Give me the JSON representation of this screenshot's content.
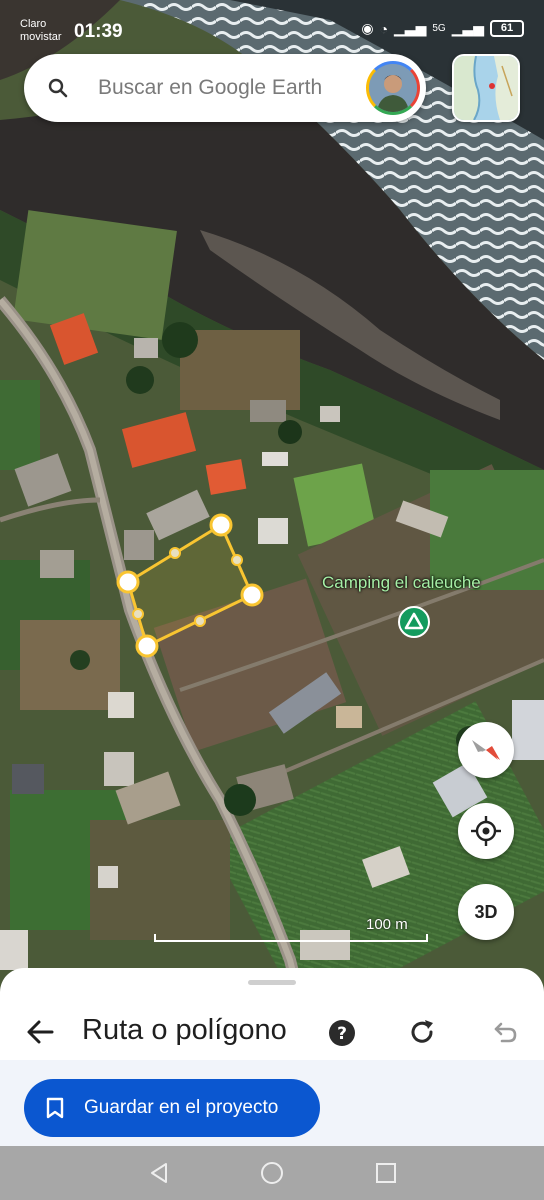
{
  "status_bar": {
    "carrier_line1": "Claro",
    "carrier_line2": "movistar",
    "time": "01:39",
    "network": "5G",
    "battery": "61"
  },
  "search": {
    "placeholder": "Buscar en Google Earth"
  },
  "map": {
    "place_label": "Camping el caleuche",
    "scale_label": "100 m",
    "button_3d": "3D",
    "polygon_color": "#f9c531"
  },
  "sheet": {
    "title": "Ruta o polígono",
    "save_label": "Guardar en el proyecto"
  },
  "colors": {
    "accent": "#0b57d0",
    "place_pin": "#149b5e"
  },
  "icons": [
    "search-icon",
    "avatar",
    "minimap-icon",
    "compass-icon",
    "my-location-icon",
    "back-arrow-icon",
    "help-icon",
    "redo-icon",
    "undo-icon",
    "bookmark-icon",
    "nav-back-icon",
    "nav-home-icon",
    "nav-recents-icon"
  ]
}
